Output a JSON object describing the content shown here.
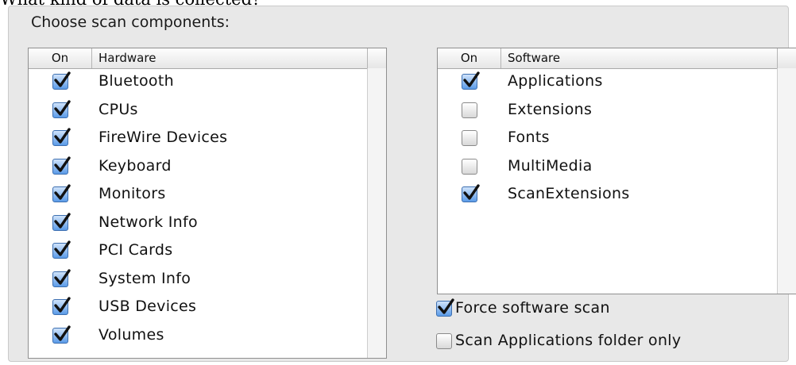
{
  "top_fragment": "What kind of data is collected?",
  "panel_title": "Choose scan components:",
  "hardware": {
    "header_on": "On",
    "header_name": "Hardware",
    "items": [
      {
        "label": "Bluetooth",
        "checked": true
      },
      {
        "label": "CPUs",
        "checked": true
      },
      {
        "label": "FireWire Devices",
        "checked": true
      },
      {
        "label": "Keyboard",
        "checked": true
      },
      {
        "label": "Monitors",
        "checked": true
      },
      {
        "label": "Network Info",
        "checked": true
      },
      {
        "label": "PCI Cards",
        "checked": true
      },
      {
        "label": "System Info",
        "checked": true
      },
      {
        "label": "USB Devices",
        "checked": true
      },
      {
        "label": "Volumes",
        "checked": true
      }
    ]
  },
  "software": {
    "header_on": "On",
    "header_name": "Software",
    "items": [
      {
        "label": "Applications",
        "checked": true
      },
      {
        "label": "Extensions",
        "checked": false
      },
      {
        "label": "Fonts",
        "checked": false
      },
      {
        "label": "MultiMedia",
        "checked": false
      },
      {
        "label": "ScanExtensions",
        "checked": true
      }
    ]
  },
  "options": {
    "force_scan": {
      "label": "Force software scan",
      "checked": true
    },
    "apps_only": {
      "label": "Scan Applications folder only",
      "checked": false
    }
  },
  "colors": {
    "panel_bg": "#e8e8e8",
    "checkbox_checked": "#5b9be8",
    "checkmark": "#111111"
  },
  "icons": {
    "checked": "checkmark-icon"
  }
}
